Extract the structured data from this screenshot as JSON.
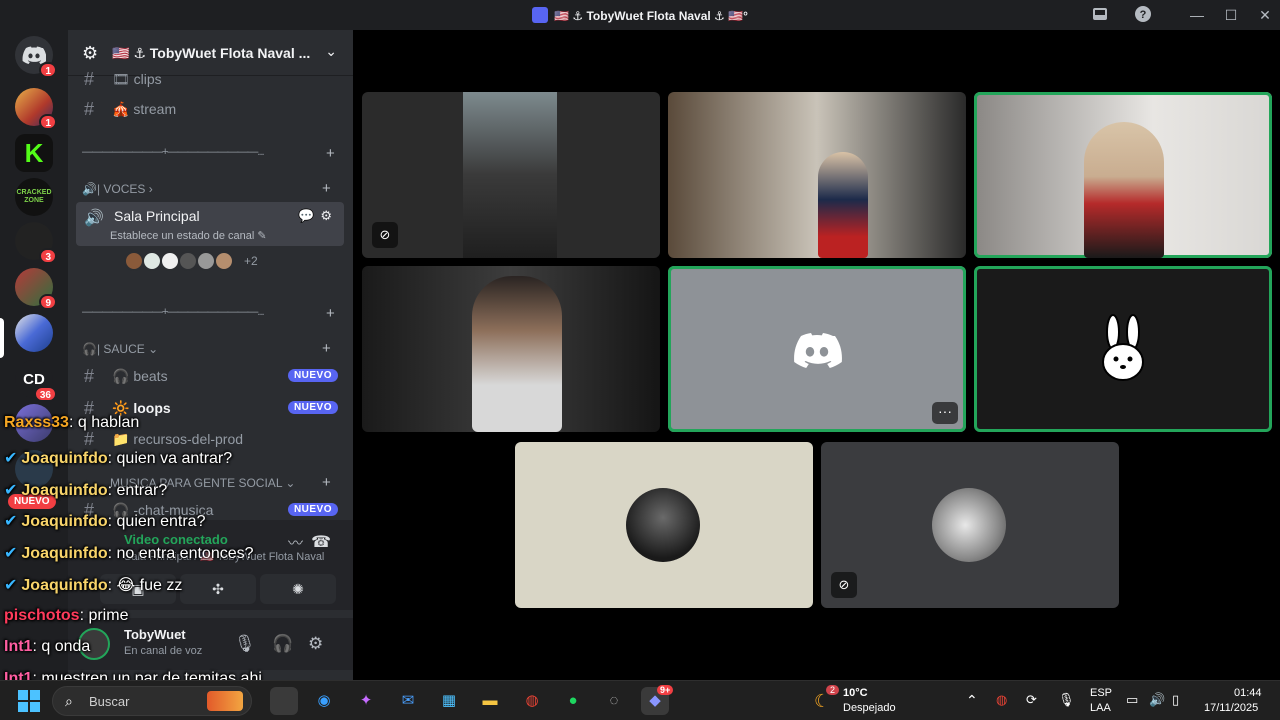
{
  "window": {
    "title": "🇺🇸 ⚓ TobyWuet Flota Naval ⚓ 🇺🇸°"
  },
  "rail": {
    "servers": [
      {
        "name": "home",
        "badge": "1",
        "color": "#5865f2"
      },
      {
        "name": "server-onepiece",
        "badge": "1",
        "color": "#c0392b"
      },
      {
        "name": "server-kick",
        "badge": "",
        "color": "#53fc18"
      },
      {
        "name": "server-cracked-zone",
        "badge": "",
        "color": "#111111",
        "text": "CRACKED ZONE"
      },
      {
        "name": "server-no-pinche",
        "badge": "3",
        "color": "#222222"
      },
      {
        "name": "server-five",
        "badge": "9",
        "color": "#2f6f3e"
      },
      {
        "name": "server-current",
        "badge": "",
        "color": "#4a6ad6"
      },
      {
        "name": "server-cd",
        "badge": "36",
        "color": "#1e1f22",
        "text": "CD"
      }
    ]
  },
  "sidebar": {
    "server_name": "🇺🇸 ⚓ TobyWuet Flota Naval ...",
    "channels_top": [
      {
        "label": "🎞 clips"
      },
      {
        "label": "🎪 stream"
      }
    ],
    "divider1": "————————+—————————...",
    "voice_category": "🔊| VOCES",
    "voice_channel": {
      "name": "Sala Principal",
      "status_placeholder": "Establece un estado de canal ✎",
      "more": "+2"
    },
    "divider2": "————————+—————————...",
    "sauce_category": "🎧| SAUCE",
    "sauce_channels": [
      {
        "label": "🎧 beats",
        "badge": "NUEVO"
      },
      {
        "label": "🔆 loops",
        "badge": "NUEVO"
      },
      {
        "label": "📁 recursos-del-prod",
        "badge": ""
      }
    ],
    "music_category": "MUSICA PARA GENTE SOCIAL",
    "music_channels": [
      {
        "label": "🎧 -chat-musica",
        "badge": "NUEVO"
      }
    ],
    "new_pill": "NUEVO"
  },
  "voice_panel": {
    "status": "Video conectado",
    "sub": "Sala Principal / 🇺🇸 TobyWuet Flota Naval"
  },
  "user_panel": {
    "username": "TobyWuet",
    "sub": "En canal de voz"
  },
  "chat": [
    {
      "user": "Raxss33",
      "text": ": q hablan",
      "color": "#f5a623",
      "verified": false
    },
    {
      "user": "Joaquinfdo",
      "text": ": quien va antrar?",
      "color": "#f8d46a",
      "verified": true
    },
    {
      "user": "Joaquinfdo",
      "text": ": entrar?",
      "color": "#f8d46a",
      "verified": true
    },
    {
      "user": "Joaquinfdo",
      "text": ": quien entra?",
      "color": "#f8d46a",
      "verified": true
    },
    {
      "user": "Joaquinfdo",
      "text": ": no entra entonces?",
      "color": "#f8d46a",
      "verified": true
    },
    {
      "user": "Joaquinfdo",
      "text": ": 😂 fue zz",
      "color": "#f8d46a",
      "verified": true
    },
    {
      "user": "pischotos",
      "text": ": prime",
      "color": "#ff3b5c",
      "verified": false
    },
    {
      "user": "Int1",
      "text": ": q onda",
      "color": "#ff5ea2",
      "verified": false
    },
    {
      "user": "Int1",
      "text": ": muestren un par de temitas ahi",
      "color": "#ff5ea2",
      "verified": false
    }
  ],
  "taskbar": {
    "search_placeholder": "Buscar",
    "weather_temp": "10°C",
    "weather_desc": "Despejado",
    "weather_badge": "2",
    "lang_top": "ESP",
    "lang_bottom": "LAA",
    "time": "01:44",
    "date": "17/11/2025",
    "discord_badge": "9+"
  },
  "colors": {
    "speaking": "#23a55a",
    "accent": "#5865f2",
    "danger": "#f23f43"
  }
}
